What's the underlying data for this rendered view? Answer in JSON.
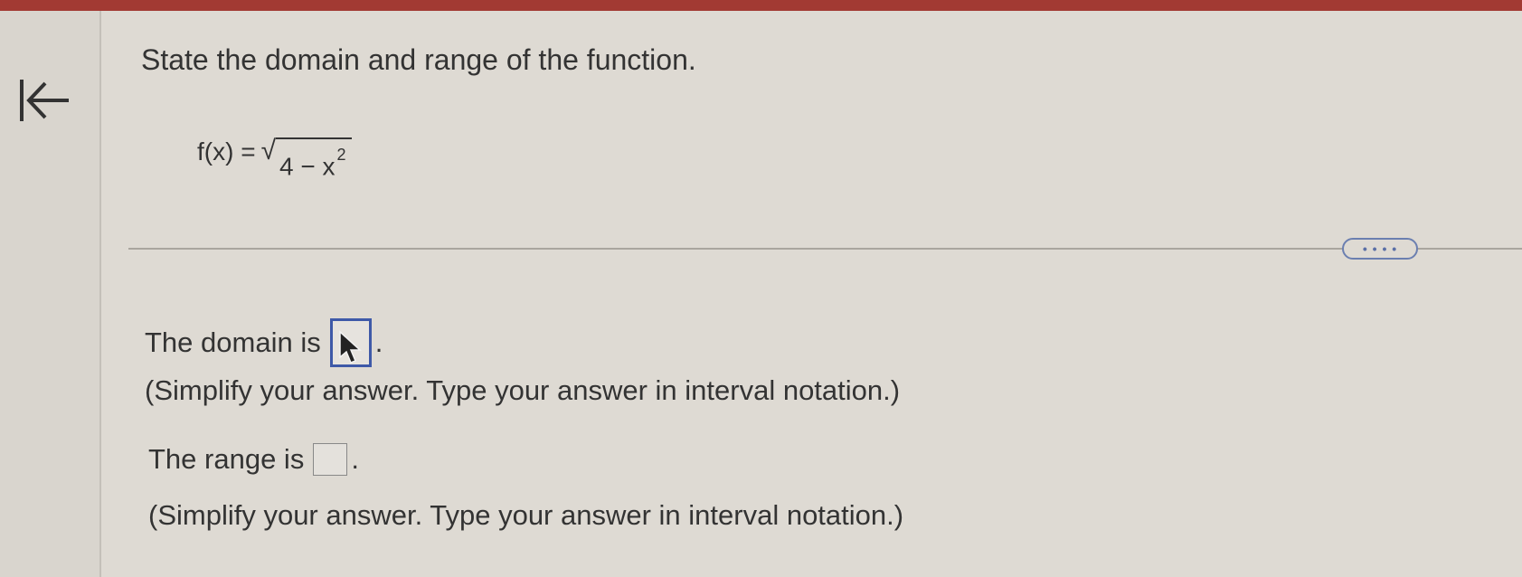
{
  "question": {
    "title": "State the domain and range of the function.",
    "function": {
      "lhs": "f(x) =",
      "radical_sign": "√",
      "radicand": "4 − x",
      "exponent": "2"
    }
  },
  "more_button": {
    "label": "• • • •"
  },
  "domain": {
    "label": "The domain is",
    "value": "",
    "suffix": ".",
    "hint": "(Simplify your answer. Type your answer in interval notation.)"
  },
  "range": {
    "label": "The range is",
    "value": "",
    "suffix": ".",
    "hint": "(Simplify your answer. Type your answer in interval notation.)"
  },
  "icons": {
    "back": "back-to-start-icon",
    "cursor": "mouse-pointer-icon"
  },
  "colors": {
    "top_bar": "#a23a33",
    "active_box_border": "#3e59a8",
    "background": "#dedad3"
  }
}
